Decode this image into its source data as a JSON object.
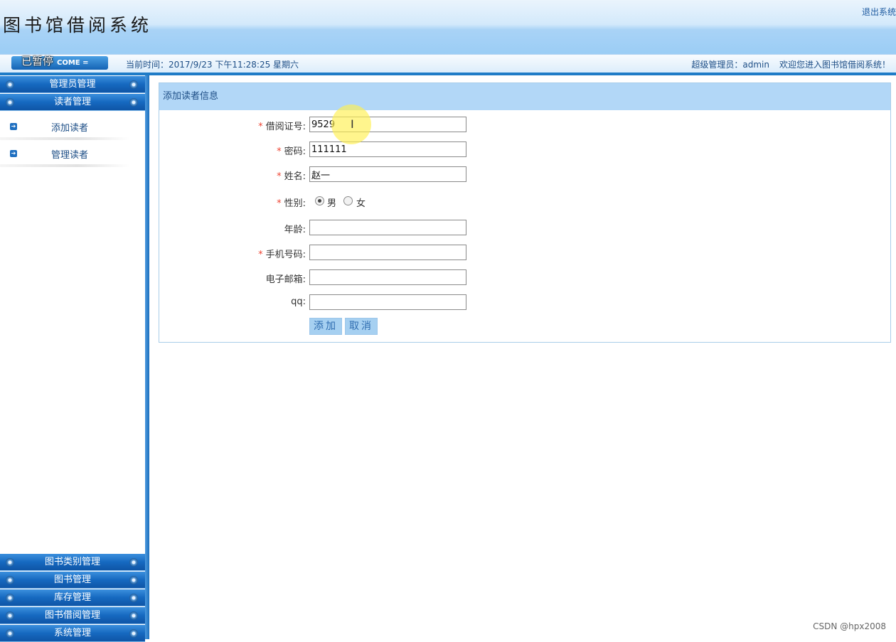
{
  "header": {
    "title": "图书馆借阅系统",
    "logout": "退出系统"
  },
  "status_bar": {
    "welcome": "COME",
    "paused_overlay": "已暂停",
    "current_time": "当前时间：2017/9/23 下午11:28:25 星期六",
    "admin": "超级管理员：admin",
    "greeting": "欢迎您进入图书馆借阅系统！"
  },
  "sidebar": {
    "top_menus": [
      "管理员管理",
      "读者管理"
    ],
    "sub_items": [
      "添加读者",
      "管理读者"
    ],
    "bottom_menus": [
      "图书类别管理",
      "图书管理",
      "库存管理",
      "图书借阅管理",
      "系统管理"
    ]
  },
  "form": {
    "title": "添加读者信息",
    "card_no": {
      "label": "借阅证号:",
      "value": "9529"
    },
    "password": {
      "label": "密码:",
      "value": "111111"
    },
    "name": {
      "label": "姓名:",
      "value": "赵一"
    },
    "gender": {
      "label": "性别:",
      "options": [
        "男",
        "女"
      ],
      "selected": "男"
    },
    "age": {
      "label": "年龄:",
      "value": ""
    },
    "phone": {
      "label": "手机号码:",
      "value": ""
    },
    "email": {
      "label": "电子邮箱:",
      "value": ""
    },
    "qq": {
      "label": "qq:",
      "value": ""
    },
    "add_button": "添加",
    "cancel_button": "取消"
  },
  "watermark": "CSDN @hpx2008"
}
